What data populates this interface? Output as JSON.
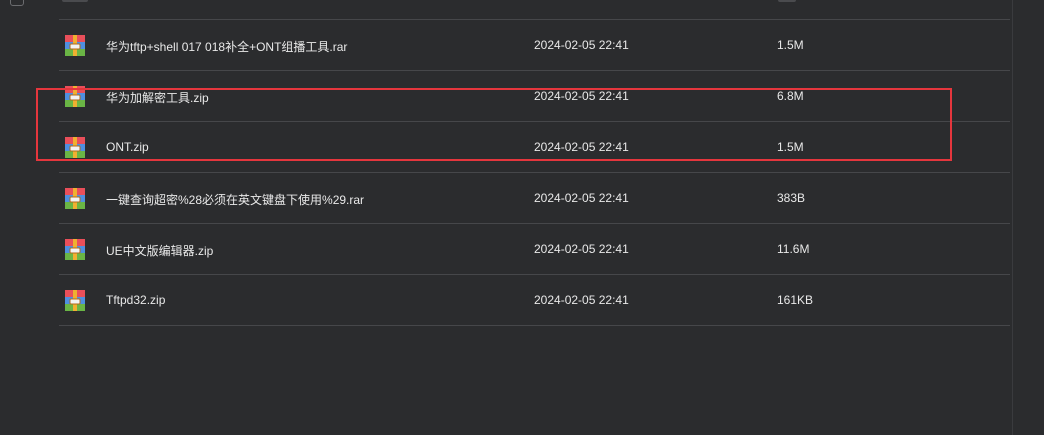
{
  "files": [
    {
      "name": "华为tftp+shell 017 018补全+ONT组播工具.rar",
      "date": "2024-02-05 22:41",
      "size": "1.5M",
      "icon": "archive-icon"
    },
    {
      "name": "华为加解密工具.zip",
      "date": "2024-02-05 22:41",
      "size": "6.8M",
      "icon": "archive-icon"
    },
    {
      "name": "ONT.zip",
      "date": "2024-02-05 22:41",
      "size": "1.5M",
      "icon": "archive-icon"
    },
    {
      "name": "一键查询超密%28必须在英文键盘下使用%29.rar",
      "date": "2024-02-05 22:41",
      "size": "383B",
      "icon": "archive-icon"
    },
    {
      "name": "UE中文版编辑器.zip",
      "date": "2024-02-05 22:41",
      "size": "11.6M",
      "icon": "archive-icon"
    },
    {
      "name": "Tftpd32.zip",
      "date": "2024-02-05 22:41",
      "size": "161KB",
      "icon": "archive-icon"
    }
  ],
  "colors": {
    "background": "#2b2c2e",
    "text": "#e9e9e9",
    "divider": "#46474a",
    "highlight": "#e5363d"
  }
}
